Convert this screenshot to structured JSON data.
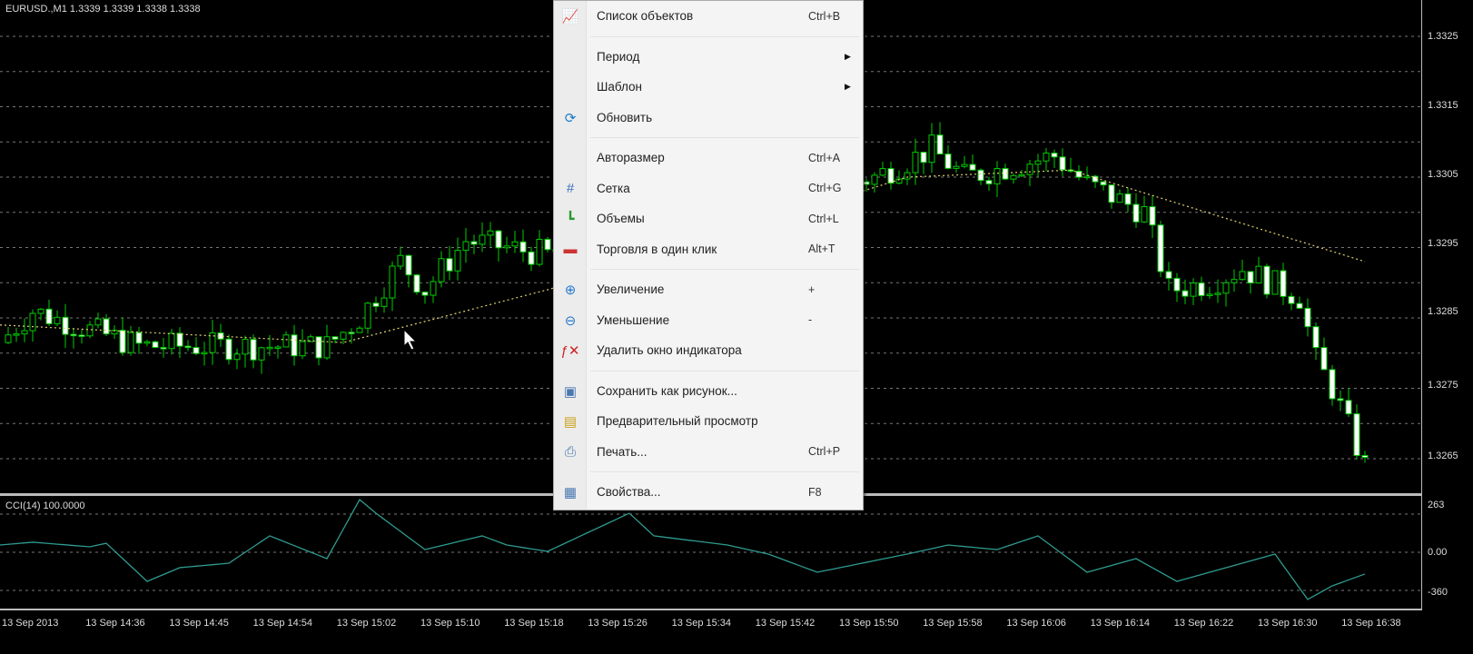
{
  "chart": {
    "title": "EURUSD.,M1  1.3339 1.3339 1.3338 1.3338",
    "indicator_title": "CCI(14) 100.0000",
    "price_labels": [
      "1.3325",
      "1.3315",
      "1.3305",
      "1.3295",
      "1.3285",
      "1.3275",
      "1.3265"
    ],
    "cci_labels": [
      "263",
      "0.00",
      "-360"
    ],
    "time_labels": [
      "13 Sep 2013",
      "13 Sep 14:36",
      "13 Sep 14:45",
      "13 Sep 14:54",
      "13 Sep 15:02",
      "13 Sep 15:10",
      "13 Sep 15:18",
      "13 Sep 15:26",
      "13 Sep 15:34",
      "13 Sep 15:42",
      "13 Sep 15:50",
      "13 Sep 15:58",
      "13 Sep 16:06",
      "13 Sep 16:14",
      "13 Sep 16:22",
      "13 Sep 16:30",
      "13 Sep 16:38"
    ],
    "colors": {
      "bull": "#00cc00",
      "bear_body": "#ffffff",
      "ma": "#e0d070",
      "cci": "#2e9b8f"
    }
  },
  "chart_data": {
    "type": "candlestick",
    "price_anchors": [
      [
        0,
        1.32815
      ],
      [
        4,
        1.3286
      ],
      [
        17,
        1.3281
      ],
      [
        28,
        1.3281
      ],
      [
        40,
        1.3281
      ],
      [
        44,
        1.3285
      ],
      [
        49,
        1.3293
      ],
      [
        52,
        1.3289
      ],
      [
        57,
        1.3296
      ],
      [
        67,
        1.3294
      ],
      [
        80,
        1.3298
      ],
      [
        107,
        1.3305
      ],
      [
        114,
        1.3309
      ],
      [
        118,
        1.3305
      ],
      [
        129,
        1.3308
      ],
      [
        133,
        1.3304
      ],
      [
        140,
        1.33
      ],
      [
        143,
        1.3289
      ],
      [
        148,
        1.329
      ],
      [
        152,
        1.3292
      ],
      [
        159,
        1.3288
      ],
      [
        161,
        1.3279
      ],
      [
        163,
        1.3275
      ],
      [
        167,
        1.3264
      ]
    ],
    "ma_anchors": [
      [
        0,
        1.3284
      ],
      [
        42,
        1.32815
      ],
      [
        67,
        1.3289
      ],
      [
        111,
        1.3305
      ],
      [
        131,
        1.3306
      ],
      [
        167,
        1.3293
      ]
    ],
    "cci_anchors": [
      [
        0,
        57
      ],
      [
        4,
        79
      ],
      [
        11,
        43
      ],
      [
        13,
        71
      ],
      [
        18,
        -229
      ],
      [
        22,
        -121
      ],
      [
        28,
        -86
      ],
      [
        33,
        129
      ],
      [
        40,
        -50
      ],
      [
        44,
        414
      ],
      [
        46,
        307
      ],
      [
        52,
        21
      ],
      [
        59,
        129
      ],
      [
        62,
        57
      ],
      [
        67,
        7
      ],
      [
        77,
        307
      ],
      [
        80,
        129
      ],
      [
        89,
        57
      ],
      [
        94,
        -14
      ],
      [
        100,
        -157
      ],
      [
        111,
        -14
      ],
      [
        116,
        57
      ],
      [
        122,
        21
      ],
      [
        127,
        129
      ],
      [
        133,
        -157
      ],
      [
        139,
        -50
      ],
      [
        144,
        -229
      ],
      [
        150,
        -121
      ],
      [
        156,
        -14
      ],
      [
        160,
        -371
      ],
      [
        163,
        -264
      ],
      [
        167,
        -171
      ]
    ]
  },
  "menu": {
    "items": [
      {
        "label": "Список объектов",
        "shortcut": "Ctrl+B",
        "icon": "object-list-icon"
      },
      {
        "sep": true
      },
      {
        "label": "Период",
        "submenu": true
      },
      {
        "label": "Шаблон",
        "submenu": true
      },
      {
        "label": "Обновить",
        "icon": "refresh-icon"
      },
      {
        "sep": true
      },
      {
        "label": "Авторазмер",
        "shortcut": "Ctrl+A"
      },
      {
        "label": "Сетка",
        "shortcut": "Ctrl+G",
        "icon": "grid-icon"
      },
      {
        "label": "Объемы",
        "shortcut": "Ctrl+L",
        "icon": "volumes-icon"
      },
      {
        "label": "Торговля в один клик",
        "shortcut": "Alt+T",
        "icon": "one-click-trading-icon"
      },
      {
        "sep": true
      },
      {
        "label": "Увеличение",
        "shortcut": "+",
        "icon": "zoom-in-icon"
      },
      {
        "label": "Уменьшение",
        "shortcut": "-",
        "icon": "zoom-out-icon"
      },
      {
        "label": "Удалить окно индикатора",
        "icon": "delete-indicator-window-icon"
      },
      {
        "sep": true
      },
      {
        "label": "Сохранить как рисунок...",
        "icon": "save-picture-icon"
      },
      {
        "label": "Предварительный просмотр",
        "icon": "print-preview-icon"
      },
      {
        "label": "Печать...",
        "shortcut": "Ctrl+P",
        "icon": "print-icon"
      },
      {
        "sep": true
      },
      {
        "label": "Свойства...",
        "shortcut": "F8",
        "icon": "properties-icon"
      }
    ]
  }
}
